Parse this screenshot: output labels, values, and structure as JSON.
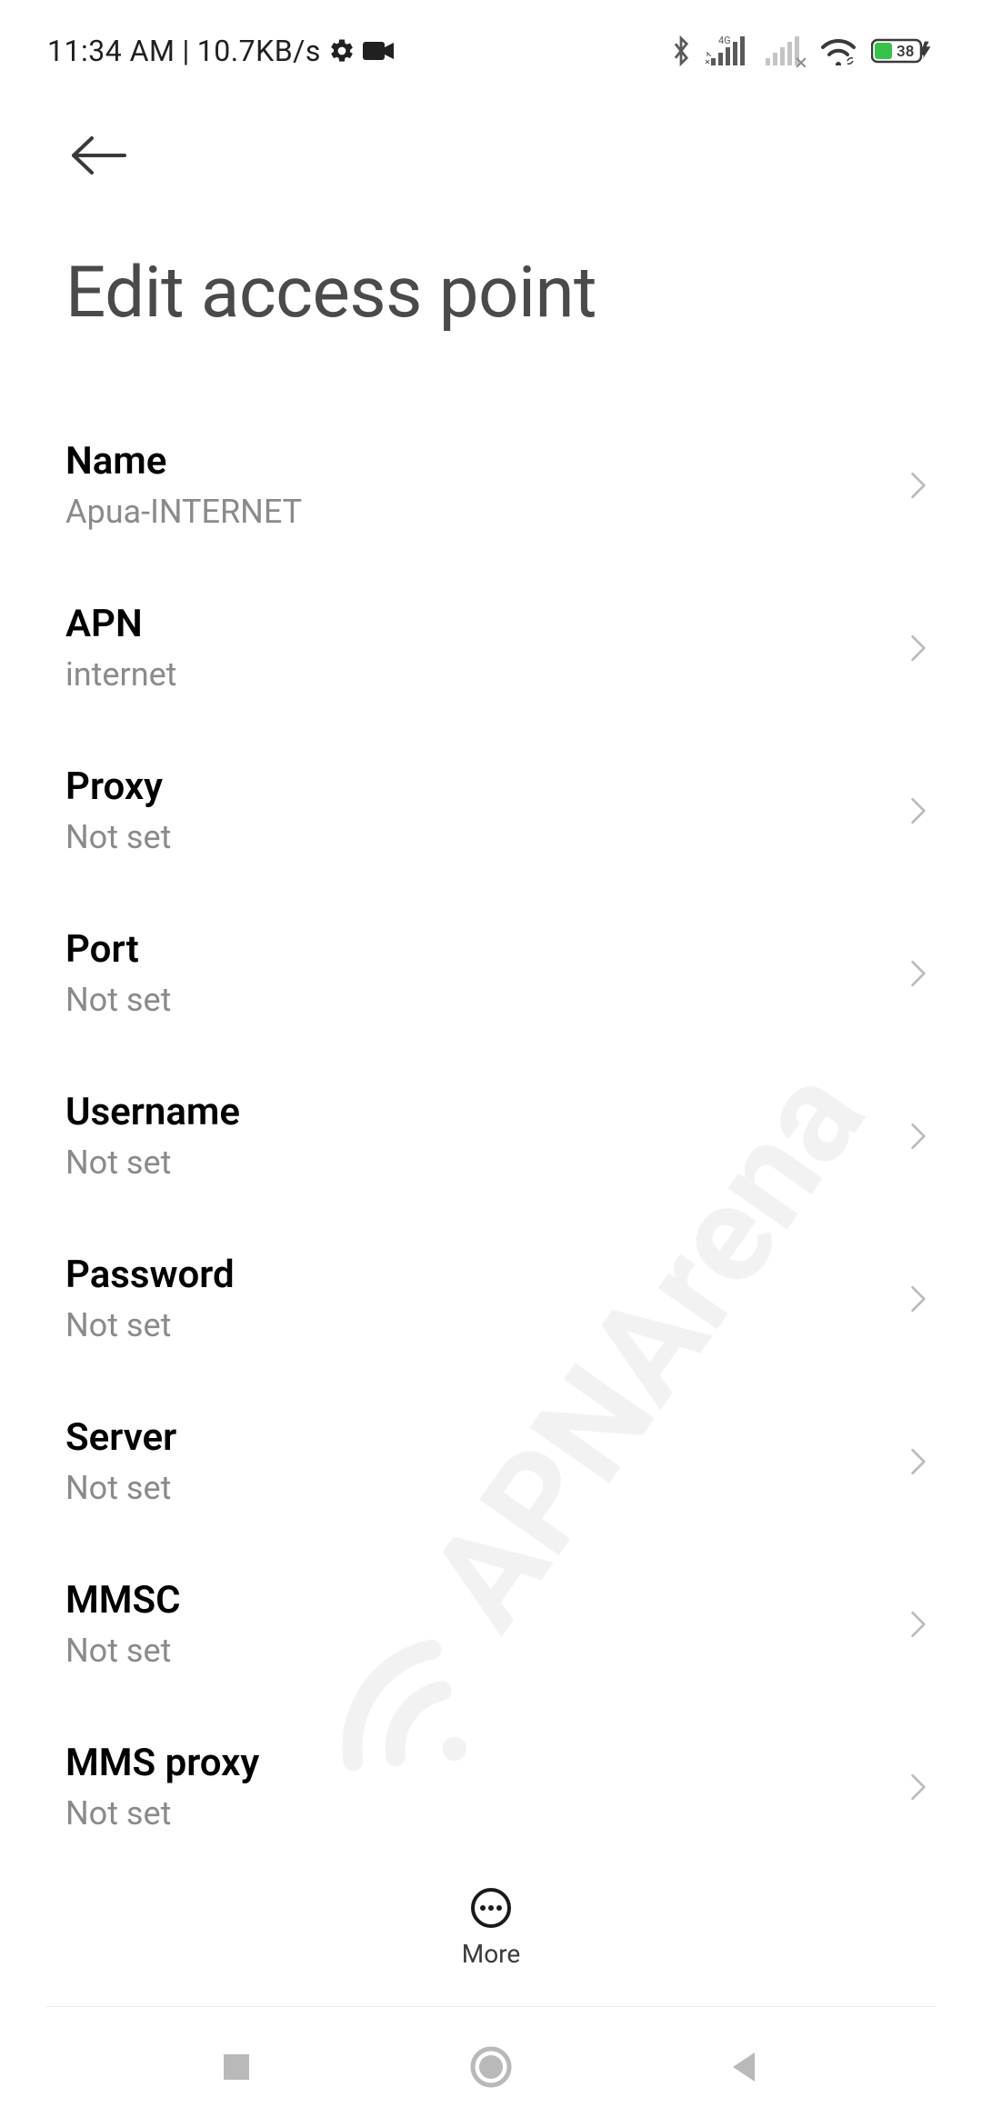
{
  "status_bar": {
    "time": "11:34 AM",
    "sep": " | ",
    "speed": "10.7KB/s",
    "icons": {
      "gear": "gear-icon",
      "camera": "camera-icon",
      "bluetooth": "bluetooth-icon",
      "signal_label": "4G",
      "wifi": "wifi-icon"
    },
    "battery": "38"
  },
  "page": {
    "title": "Edit access point"
  },
  "settings": [
    {
      "label": "Name",
      "value": "Apua-INTERNET"
    },
    {
      "label": "APN",
      "value": "internet"
    },
    {
      "label": "Proxy",
      "value": "Not set"
    },
    {
      "label": "Port",
      "value": "Not set"
    },
    {
      "label": "Username",
      "value": "Not set"
    },
    {
      "label": "Password",
      "value": "Not set"
    },
    {
      "label": "Server",
      "value": "Not set"
    },
    {
      "label": "MMSC",
      "value": "Not set"
    },
    {
      "label": "MMS proxy",
      "value": "Not set"
    }
  ],
  "more": {
    "label": "More"
  },
  "watermark": {
    "text": "APNArena"
  }
}
